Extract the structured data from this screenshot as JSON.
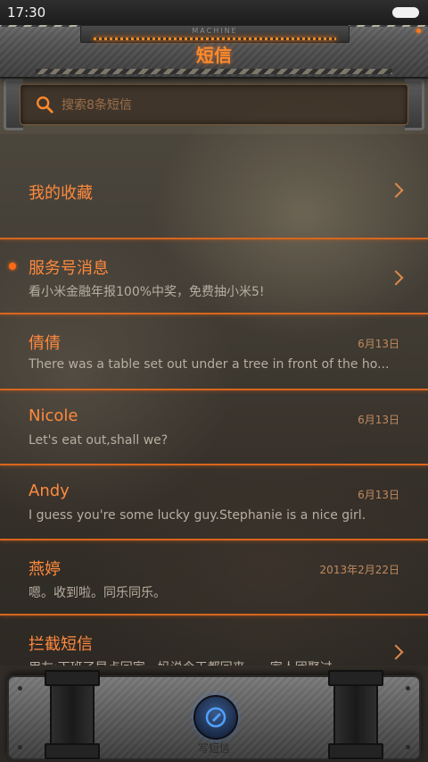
{
  "status_bar": {
    "time": "17:30"
  },
  "header": {
    "plate_text": "MACHINE",
    "title": "短信"
  },
  "search": {
    "placeholder": "搜索8条短信"
  },
  "conversations": [
    {
      "title": "我的收藏",
      "subtitle": "",
      "date": "",
      "chevron": true,
      "unread": false
    },
    {
      "title": "服务号消息",
      "subtitle": "看小米金融年报100%中奖，免费抽小米5!",
      "date": "",
      "chevron": true,
      "unread": true
    },
    {
      "title": "倩倩",
      "subtitle": "There was a table set out under a tree in front of the ho...",
      "date": "6月13日",
      "chevron": false,
      "unread": false
    },
    {
      "title": "Nicole",
      "subtitle": "Let's eat out,shall we?",
      "date": "6月13日",
      "chevron": false,
      "unread": false
    },
    {
      "title": "Andy",
      "subtitle": "I guess you're some lucky guy.Stephanie is a nice girl.",
      "date": "6月13日",
      "chevron": false,
      "unread": false
    },
    {
      "title": "燕婷",
      "subtitle": "嗯。收到啦。同乐同乐。",
      "date": "2013年2月22日",
      "chevron": false,
      "unread": false
    },
    {
      "title": "拦截短信",
      "subtitle": "用友:下班了早点回家，妈说今天都回来……家人团聚过",
      "date": "",
      "chevron": true,
      "unread": false
    }
  ],
  "bottom_bar": {
    "compose_label": "写短信"
  },
  "colors": {
    "accent": "#ff8a3d",
    "separator": "#d6661f",
    "compose": "#3a5a8a"
  },
  "icons": {
    "search": "search-icon",
    "compose": "compose-icon",
    "chevron": "chevron-right-icon"
  }
}
